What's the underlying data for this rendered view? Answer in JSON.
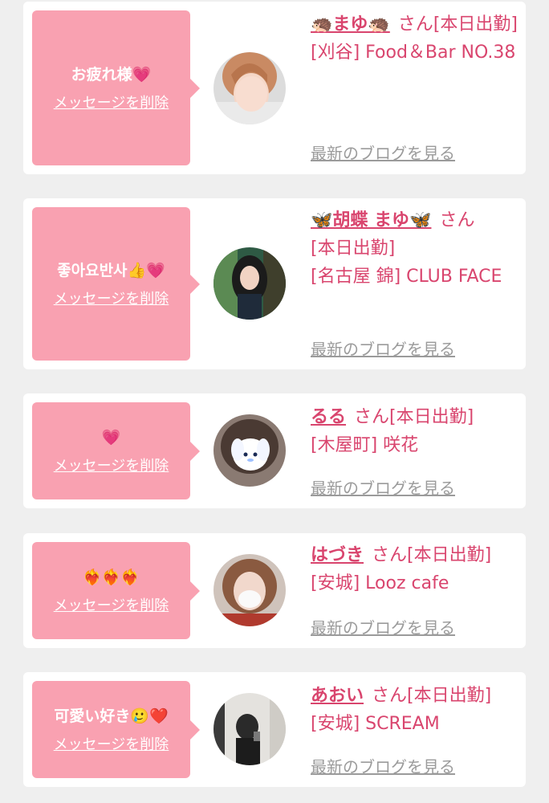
{
  "cards": [
    {
      "message": "お疲れ様💗",
      "delete_label": "メッセージを削除",
      "name": "🦔まゆ🦔",
      "honorific": "さん",
      "status": "[本日出勤]",
      "shop": "[刈谷] Food＆Bar NO.38",
      "blog_link": "最新のブログを見る"
    },
    {
      "message": "좋아요반사👍💗",
      "delete_label": "メッセージを削除",
      "name": "🦋胡蝶 まゆ🦋",
      "honorific": "さん",
      "status": "[本日出勤]",
      "shop": "[名古屋 錦] CLUB FACE",
      "blog_link": "最新のブログを見る"
    },
    {
      "message": "💗",
      "delete_label": "メッセージを削除",
      "name": "るる",
      "honorific": "さん",
      "status": "[本日出勤]",
      "shop": "[木屋町] 咲花",
      "blog_link": "最新のブログを見る"
    },
    {
      "message": "❤️‍🔥❤️‍🔥❤️‍🔥",
      "delete_label": "メッセージを削除",
      "name": "はづき",
      "honorific": "さん",
      "status": "[本日出勤]",
      "shop": "[安城] Looz cafe",
      "blog_link": "最新のブログを見る"
    },
    {
      "message": "可愛い好き🥲❤️",
      "delete_label": "メッセージを削除",
      "name": "あおい",
      "honorific": "さん",
      "status": "[本日出勤]",
      "shop": "[安城] SCREAM",
      "blog_link": "最新のブログを見る"
    }
  ],
  "colors": {
    "background": "#efefef",
    "bubble": "#f9a1b1",
    "name_pink": "#d9456e",
    "blog_gray": "#9b9b9b"
  }
}
